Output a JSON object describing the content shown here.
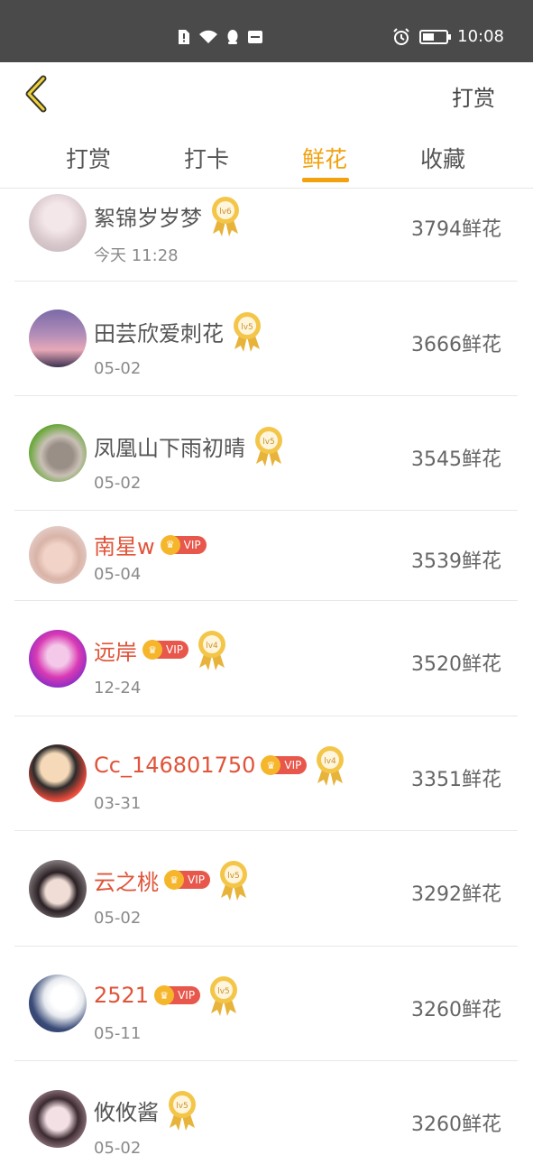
{
  "status": {
    "time": "10:08"
  },
  "header": {
    "action_label": "打赏"
  },
  "tabs": [
    "打赏",
    "打卡",
    "鲜花",
    "收藏"
  ],
  "active_tab_index": 2,
  "rows": [
    {
      "name": "絮锦岁岁梦",
      "vip": false,
      "level": "lv6",
      "date": "今天 11:28",
      "amount": "3794鲜花"
    },
    {
      "name": "田芸欣爱刺花",
      "vip": false,
      "level": "lv5",
      "date": "05-02",
      "amount": "3666鲜花"
    },
    {
      "name": "凤凰山下雨初晴",
      "vip": false,
      "level": "lv5",
      "date": "05-02",
      "amount": "3545鲜花"
    },
    {
      "name": "南星w",
      "vip": true,
      "level": "",
      "date": "05-04",
      "amount": "3539鲜花"
    },
    {
      "name": "远岸",
      "vip": true,
      "level": "lv4",
      "date": "12-24",
      "amount": "3520鲜花"
    },
    {
      "name": "Cc_146801750",
      "vip": true,
      "level": "lv4",
      "date": "03-31",
      "amount": "3351鲜花"
    },
    {
      "name": "云之桃",
      "vip": true,
      "level": "lv5",
      "date": "05-02",
      "amount": "3292鲜花"
    },
    {
      "name": "2521",
      "vip": true,
      "level": "lv5",
      "date": "05-11",
      "amount": "3260鲜花"
    },
    {
      "name": "攸攸酱",
      "vip": false,
      "level": "lv5",
      "date": "05-02",
      "amount": "3260鲜花"
    }
  ],
  "vip_label": "VIP",
  "colors": {
    "accent": "#f2a10f",
    "vip_name": "#e0543a",
    "vip_badge": "#e8574b",
    "status_bar": "#4a4a4a"
  }
}
